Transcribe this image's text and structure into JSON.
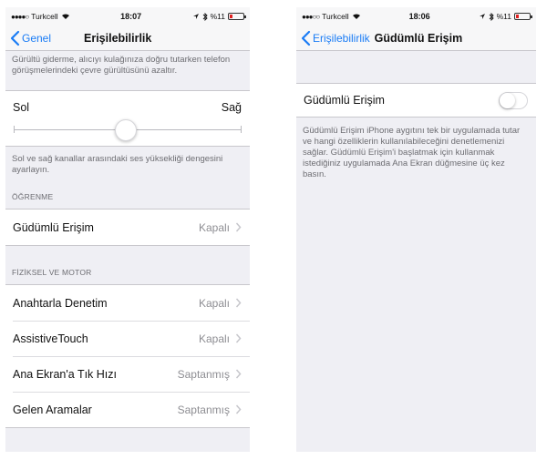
{
  "colors": {
    "accent": "#1a7cf5",
    "background": "#efeff4",
    "secondary_text": "#6d6d72",
    "value_text": "#8e8e93"
  },
  "left_screen": {
    "status": {
      "carrier": "Turkcell",
      "time": "18:07",
      "battery": "%11"
    },
    "nav": {
      "back_label": "Genel",
      "title": "Erişilebilirlik"
    },
    "intro_text": "Gürültü giderme, alıcıyı kulağınıza doğru tutarken telefon görüşmelerindeki çevre gürültüsünü azaltır.",
    "balance": {
      "left_label": "Sol",
      "right_label": "Sağ",
      "value_fraction": 0.5
    },
    "balance_text": "Sol ve sağ kanallar arasındaki ses yüksekliği dengesini ayarlayın.",
    "learning_header": "ÖĞRENME",
    "learning_rows": [
      {
        "label": "Güdümlü Erişim",
        "value": "Kapalı"
      }
    ],
    "motor_header": "FİZİKSEL VE MOTOR",
    "motor_rows": [
      {
        "label": "Anahtarla Denetim",
        "value": "Kapalı"
      },
      {
        "label": "AssistiveTouch",
        "value": "Kapalı"
      },
      {
        "label": "Ana Ekran'a Tık Hızı",
        "value": "Saptanmış"
      },
      {
        "label": "Gelen Aramalar",
        "value": "Saptanmış"
      }
    ]
  },
  "right_screen": {
    "status": {
      "carrier": "Turkcell",
      "time": "18:06",
      "battery": "%11"
    },
    "nav": {
      "back_label": "Erişilebilirlik",
      "title": "Güdümlü Erişim"
    },
    "toggle_row": {
      "label": "Güdümlü Erişim",
      "state": "off"
    },
    "description": "Güdümlü Erişim iPhone aygıtını tek bir uygulamada tutar ve hangi özelliklerin kullanılabileceğini denetlemenizi sağlar. Güdümlü Erişim'i başlatmak için kullanmak istediğiniz uygulamada Ana Ekran düğmesine üç kez basın."
  }
}
